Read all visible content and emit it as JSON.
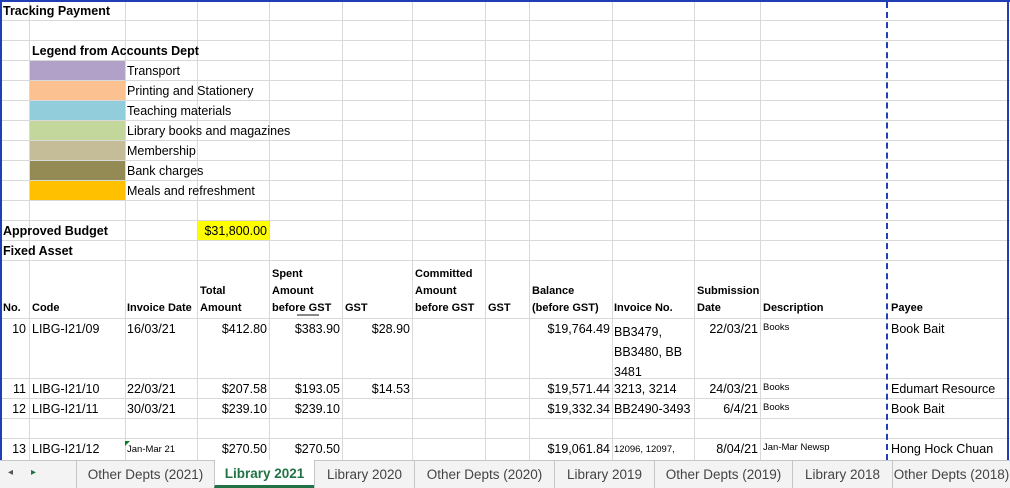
{
  "sheet": {
    "title": "Tracking Payment",
    "legend_title": "Legend from Accounts Dept",
    "legend": [
      {
        "label": "Transport",
        "color": "#b1a0c7"
      },
      {
        "label": "Printing and Stationery",
        "color": "#fcc190"
      },
      {
        "label": "Teaching materials",
        "color": "#92cddc"
      },
      {
        "label": "Library books and magazines",
        "color": "#c3d69b"
      },
      {
        "label": "Membership",
        "color": "#c4bd97"
      },
      {
        "label": "Bank charges",
        "color": "#948a54"
      },
      {
        "label": "Meals and refreshment",
        "color": "#ffc000"
      }
    ],
    "approved_budget_label": "Approved Budget",
    "approved_budget_value": "$31,800.00",
    "highlight_color": "#ffff00",
    "fixed_asset_label": "Fixed Asset",
    "headers": {
      "no": "No.",
      "code": "Code",
      "invoice_date": "Invoice Date",
      "total_amount": "Total Amount",
      "spent": "Spent Amount before GST",
      "gst": "GST",
      "committed": "Committed Amount before GST",
      "gst2": "GST",
      "balance": "Balance (before GST)",
      "invoice_no": "Invoice No.",
      "submission_date": "Submission Date",
      "description": "Description",
      "payee": "Payee"
    },
    "rows": [
      {
        "no": "10",
        "code": "LIBG-I21/09",
        "invoice_date": "16/03/21",
        "total": "$412.80",
        "spent": "$383.90",
        "gst": "$28.90",
        "balance": "$19,764.49",
        "invoice_no": "BB3479, BB3480, BB 3481",
        "submission": "22/03/21",
        "description": "Books",
        "payee": "Book Bait"
      },
      {
        "no": "11",
        "code": "LIBG-I21/10",
        "invoice_date": "22/03/21",
        "total": "$207.58",
        "spent": "$193.05",
        "gst": "$14.53",
        "balance": "$19,571.44",
        "invoice_no": "3213, 3214",
        "submission": "24/03/21",
        "description": "Books",
        "payee": "Edumart Resource"
      },
      {
        "no": "12",
        "code": "LIBG-I21/11",
        "invoice_date": "30/03/21",
        "total": "$239.10",
        "spent": "$239.10",
        "gst": "",
        "balance": "$19,332.34",
        "invoice_no": "BB2490-3493",
        "submission": "6/4/21",
        "description": "Books",
        "payee": "Book Bait"
      },
      {
        "no": "13",
        "code": "LIBG-I21/12",
        "invoice_date": "Jan-Mar 21",
        "total": "$270.50",
        "spent": "$270.50",
        "gst": "",
        "balance": "$19,061.84",
        "invoice_no": "12096, 12097,",
        "submission": "8/04/21",
        "description": "Jan-Mar Newsp",
        "payee": "Hong Hock Chuan"
      }
    ]
  },
  "tabs": [
    {
      "label": "Other Depts (2021)",
      "active": false
    },
    {
      "label": "Library 2021",
      "active": true
    },
    {
      "label": "Library 2020",
      "active": false
    },
    {
      "label": "Other Depts (2020)",
      "active": false
    },
    {
      "label": "Library 2019",
      "active": false
    },
    {
      "label": "Other Depts (2019)",
      "active": false
    },
    {
      "label": "Library 2018",
      "active": false
    },
    {
      "label": "Other Depts (2018)",
      "active": false
    }
  ],
  "nav": {
    "prev_icon": "◂",
    "next_icon": "▸"
  }
}
